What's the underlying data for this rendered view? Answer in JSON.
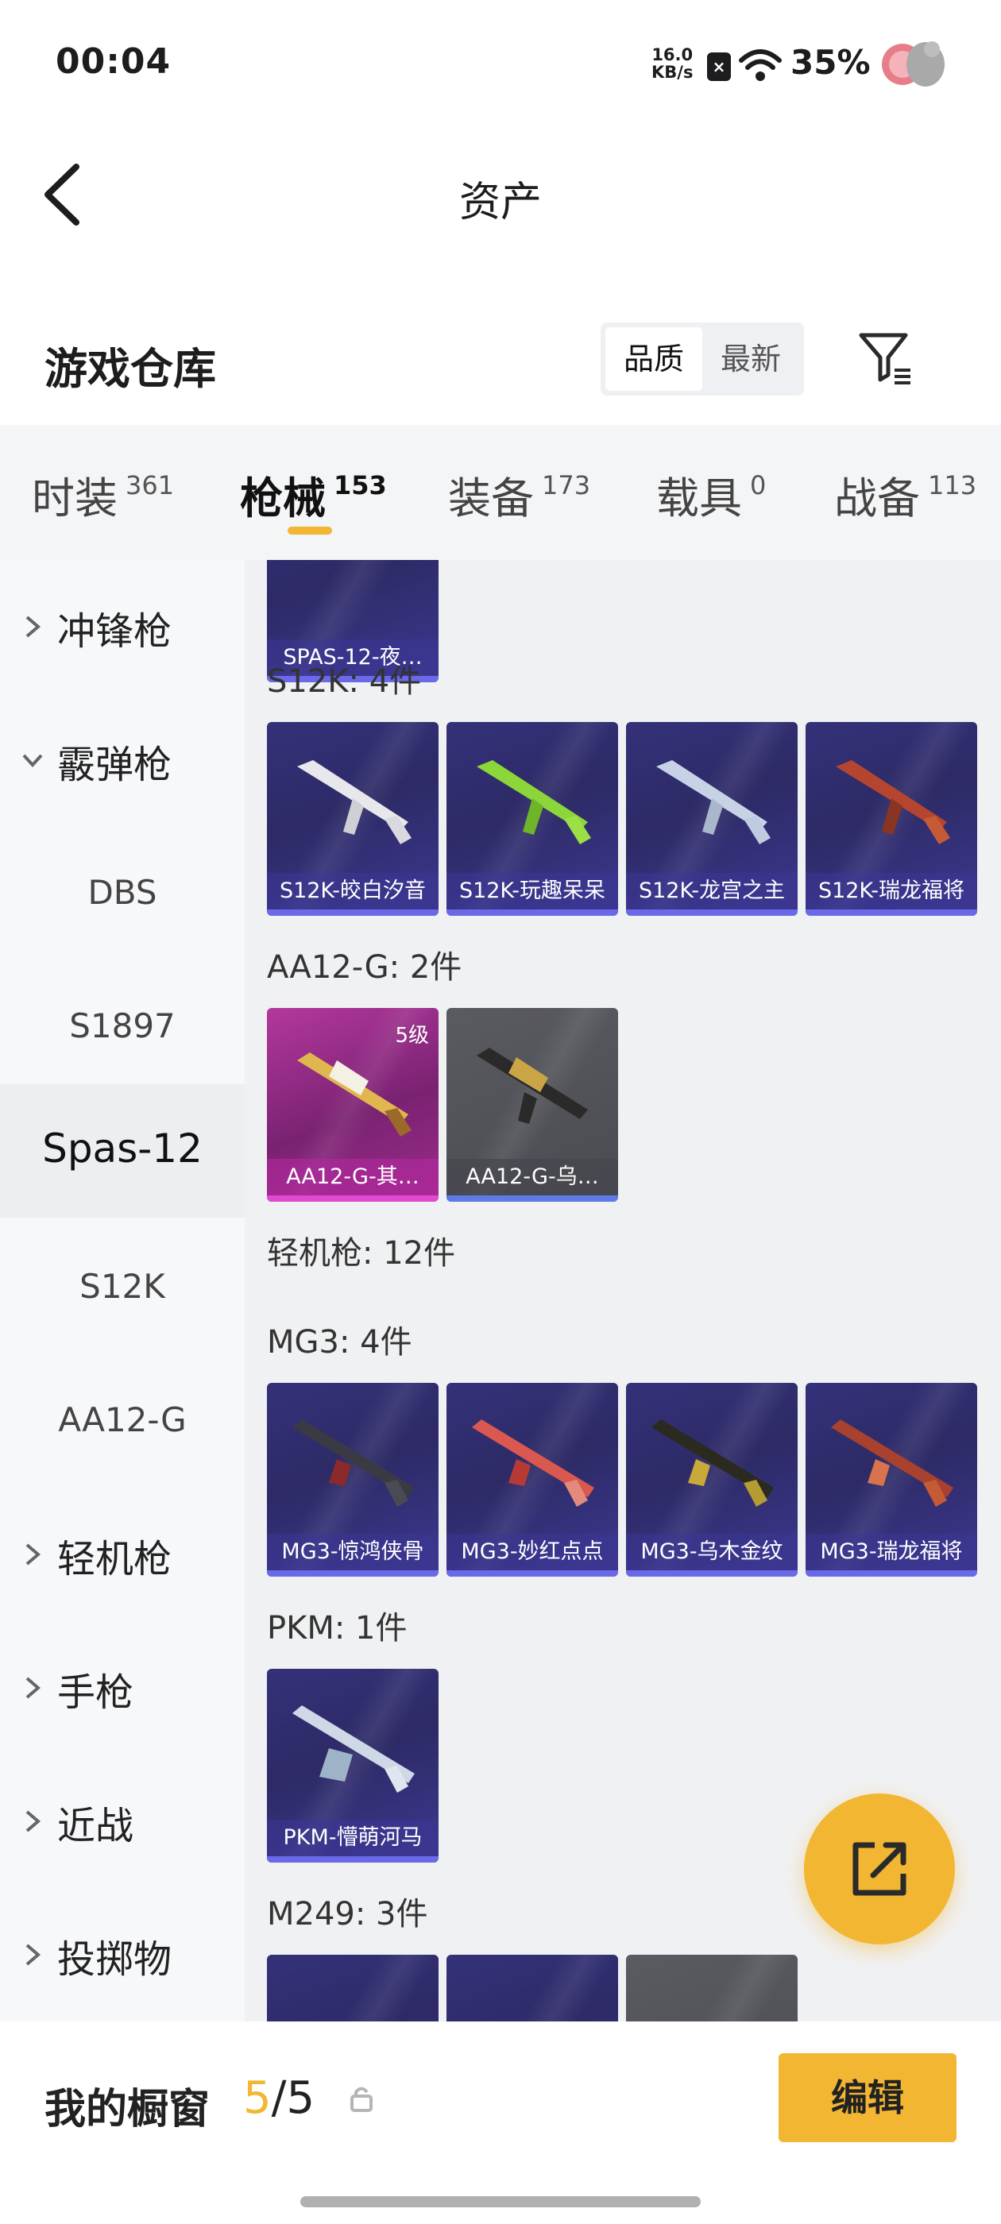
{
  "status_bar": {
    "time": "00:04",
    "net_speed_value": "16.0",
    "net_speed_unit": "KB/s",
    "battery": "35%"
  },
  "header": {
    "title": "资产"
  },
  "warehouse": {
    "title": "游戏仓库",
    "sort_options": [
      "品质",
      "最新"
    ],
    "sort_selected": "品质"
  },
  "categories": [
    {
      "label": "时装",
      "count": "361"
    },
    {
      "label": "枪械",
      "count": "153"
    },
    {
      "label": "装备",
      "count": "173"
    },
    {
      "label": "载具",
      "count": "0"
    },
    {
      "label": "战备",
      "count": "113"
    }
  ],
  "sidebar": {
    "items": [
      {
        "label": "冲锋枪",
        "expandable": true
      },
      {
        "label": "霰弹枪",
        "expandable": true,
        "expanded": true
      },
      {
        "label": "DBS"
      },
      {
        "label": "S1897"
      },
      {
        "label": "Spas-12",
        "selected": true
      },
      {
        "label": "S12K"
      },
      {
        "label": "AA12-G"
      },
      {
        "label": "轻机枪",
        "expandable": true
      },
      {
        "label": "手枪",
        "expandable": true
      },
      {
        "label": "近战",
        "expandable": true
      },
      {
        "label": "投掷物",
        "expandable": true
      }
    ]
  },
  "content": {
    "top_partial_card": "SPAS-12-夜…",
    "sections": [
      {
        "heading": "S12K: 4件",
        "items": [
          "S12K-皎白汐音",
          "S12K-玩趣呆呆",
          "S12K-龙宫之主",
          "S12K-瑞龙福将"
        ]
      },
      {
        "heading": "AA12-G: 2件",
        "items": [
          "AA12-G-其…",
          "AA12-G-乌…"
        ],
        "first_item_level": "5级"
      },
      {
        "heading": "轻机枪: 12件"
      },
      {
        "heading": "MG3: 4件",
        "items": [
          "MG3-惊鸿侠骨",
          "MG3-妙红点点",
          "MG3-乌木金纹",
          "MG3-瑞龙福将"
        ]
      },
      {
        "heading": "PKM: 1件",
        "items": [
          "PKM-懵萌河马"
        ]
      },
      {
        "heading": "M249: 3件"
      }
    ]
  },
  "showcase": {
    "label": "我的橱窗",
    "current": "5",
    "separator": "/",
    "max": "5",
    "edit_label": "编辑"
  },
  "colors": {
    "accent": "#f2b632",
    "card_blue": "#34317a",
    "card_purple": "#b3389d",
    "card_grey": "#5a5b61"
  },
  "icons": [
    "back-arrow-icon",
    "filter-icon",
    "chevron-right-icon",
    "chevron-down-icon",
    "share-icon",
    "lock-icon",
    "wifi-icon",
    "sim-icon"
  ]
}
